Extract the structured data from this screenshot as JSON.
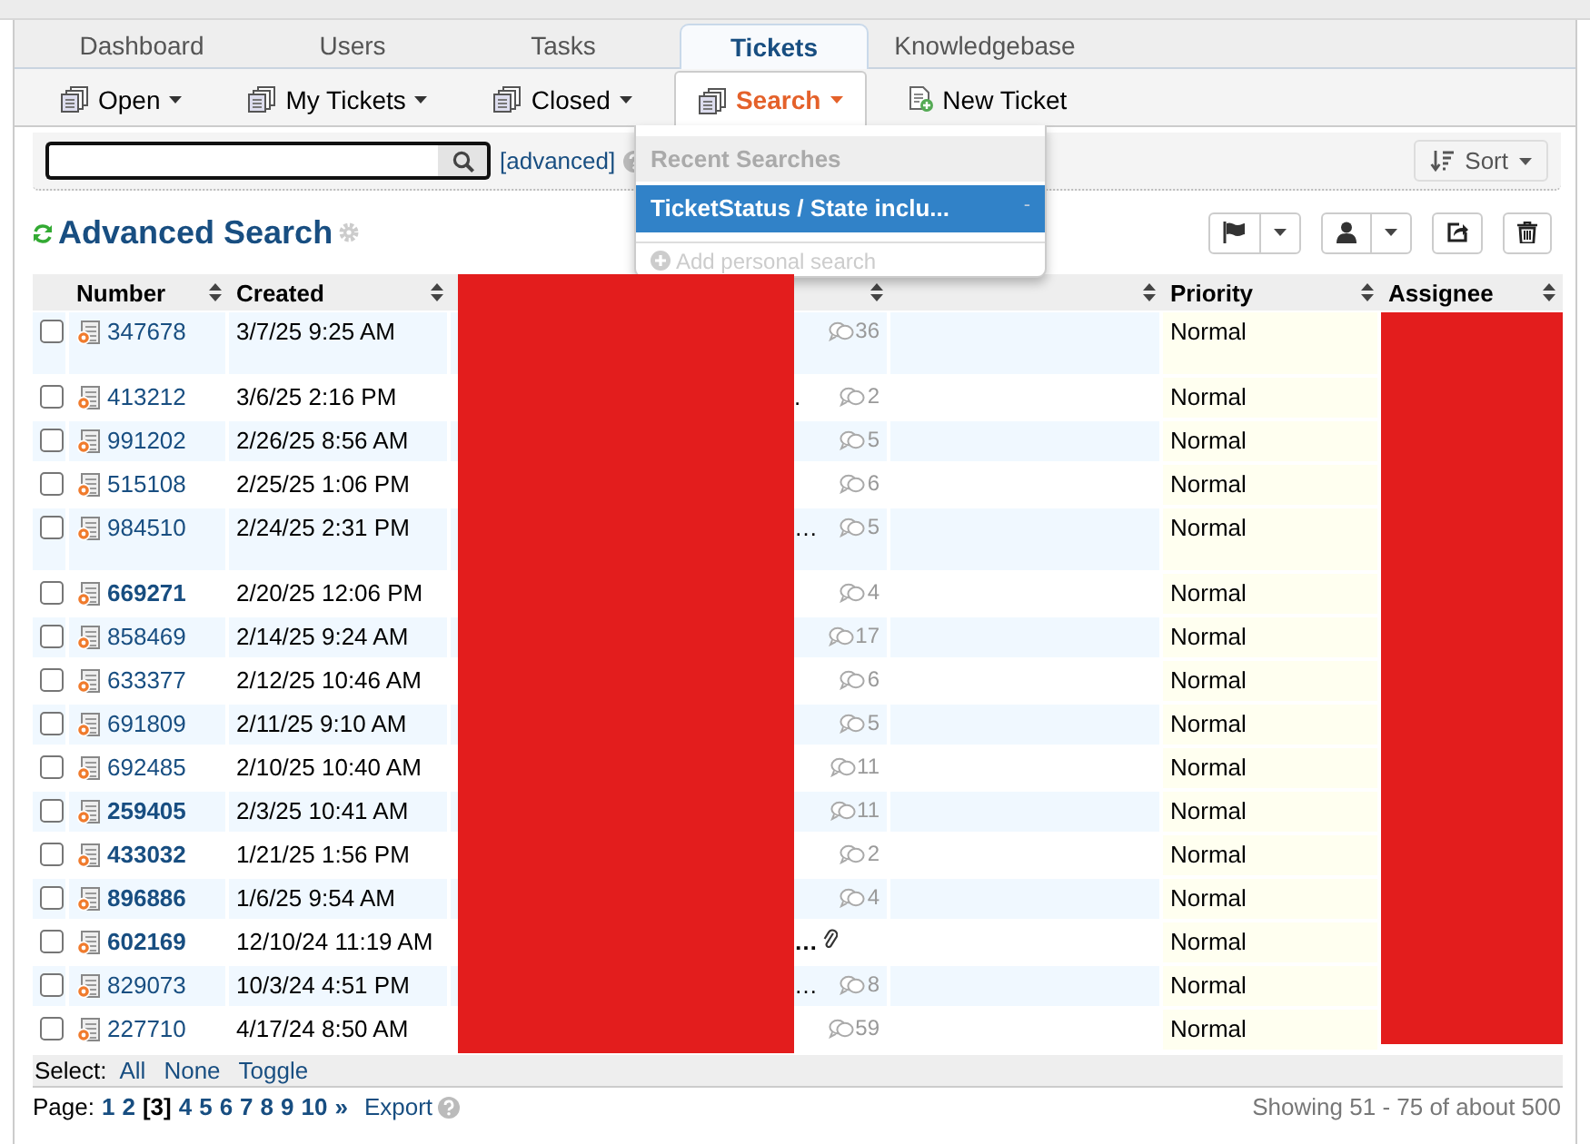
{
  "top_tabs": [
    {
      "label": "Dashboard",
      "selected": false
    },
    {
      "label": "Users",
      "selected": false
    },
    {
      "label": "Tasks",
      "selected": false
    },
    {
      "label": "Tickets",
      "selected": true
    },
    {
      "label": "Knowledgebase",
      "selected": false
    }
  ],
  "sub_nav": [
    {
      "label": "Open",
      "kind": "queue",
      "dropdown": true,
      "selected": false
    },
    {
      "label": "My Tickets",
      "kind": "queue",
      "dropdown": true,
      "selected": false
    },
    {
      "label": "Closed",
      "kind": "queue",
      "dropdown": true,
      "selected": false
    },
    {
      "label": "Search",
      "kind": "queue",
      "dropdown": true,
      "selected": true
    },
    {
      "label": "New Ticket",
      "kind": "create",
      "dropdown": false,
      "selected": false
    }
  ],
  "search_bar": {
    "advanced_link": "[advanced]",
    "sort_button": "Sort"
  },
  "search_menu": {
    "header": "Recent Searches",
    "items": [
      {
        "label": "TicketStatus / State inclu...",
        "remove": "-",
        "selected": true
      }
    ],
    "add_item": {
      "label": "Add personal search",
      "disabled": true
    }
  },
  "heading": "Advanced Search",
  "table": {
    "columns": [
      {
        "kind": "checkbox"
      },
      {
        "kind": "number",
        "label": "Number"
      },
      {
        "kind": "text",
        "label": "Created"
      },
      {
        "kind": "subject"
      },
      {
        "kind": "blank"
      },
      {
        "kind": "priority",
        "label": "Priority"
      },
      {
        "kind": "redacted",
        "label": "Assignee"
      }
    ],
    "rows": [
      {
        "number": "347678",
        "unread": false,
        "created": "3/7/25 9:25 AM",
        "count": "36",
        "attachment": false,
        "priority": "Normal",
        "checked": false,
        "tall": true
      },
      {
        "number": "413212",
        "unread": false,
        "created": "3/6/25 2:16 PM",
        "subject_tail": ".",
        "count": "2",
        "attachment": false,
        "priority": "Normal",
        "checked": false,
        "tall": false
      },
      {
        "number": "991202",
        "unread": false,
        "created": "2/26/25 8:56 AM",
        "count": "5",
        "attachment": false,
        "priority": "Normal",
        "checked": false,
        "tall": false
      },
      {
        "number": "515108",
        "unread": false,
        "created": "2/25/25 1:06 PM",
        "count": "6",
        "attachment": false,
        "priority": "Normal",
        "checked": false,
        "tall": false
      },
      {
        "number": "984510",
        "unread": false,
        "created": "2/24/25 2:31 PM",
        "subject_tail": "…",
        "count": "5",
        "attachment": false,
        "priority": "Normal",
        "checked": false,
        "tall": true
      },
      {
        "number": "669271",
        "unread": true,
        "created": "2/20/25 12:06 PM",
        "count": "4",
        "attachment": false,
        "priority": "Normal",
        "checked": false,
        "tall": false
      },
      {
        "number": "858469",
        "unread": false,
        "created": "2/14/25 9:24 AM",
        "count": "17",
        "attachment": false,
        "priority": "Normal",
        "checked": false,
        "tall": false
      },
      {
        "number": "633377",
        "unread": false,
        "created": "2/12/25 10:46 AM",
        "count": "6",
        "attachment": false,
        "priority": "Normal",
        "checked": false,
        "tall": false
      },
      {
        "number": "691809",
        "unread": false,
        "created": "2/11/25 9:10 AM",
        "count": "5",
        "attachment": false,
        "priority": "Normal",
        "checked": false,
        "tall": false
      },
      {
        "number": "692485",
        "unread": false,
        "created": "2/10/25 10:40 AM",
        "count": "11",
        "attachment": false,
        "priority": "Normal",
        "checked": false,
        "tall": false
      },
      {
        "number": "259405",
        "unread": true,
        "created": "2/3/25 10:41 AM",
        "count": "11",
        "attachment": false,
        "priority": "Normal",
        "checked": false,
        "tall": false
      },
      {
        "number": "433032",
        "unread": true,
        "created": "1/21/25 1:56 PM",
        "count": "2",
        "attachment": false,
        "priority": "Normal",
        "checked": false,
        "tall": false
      },
      {
        "number": "896886",
        "unread": true,
        "created": "1/6/25 9:54 AM",
        "count": "4",
        "attachment": false,
        "priority": "Normal",
        "checked": false,
        "tall": false
      },
      {
        "number": "602169",
        "unread": true,
        "created": "12/10/24 11:19 AM",
        "subject_tail": "…",
        "attachment": true,
        "priority": "Normal",
        "checked": false,
        "tall": false
      },
      {
        "number": "829073",
        "unread": false,
        "created": "10/3/24 4:51 PM",
        "subject_tail": "…",
        "count": "8",
        "attachment": false,
        "priority": "Normal",
        "checked": false,
        "tall": false
      },
      {
        "number": "227710",
        "unread": false,
        "created": "4/17/24 8:50 AM",
        "count": "59",
        "attachment": false,
        "priority": "Normal",
        "checked": false,
        "tall": false
      }
    ]
  },
  "select_bar": {
    "label": "Select:",
    "links": [
      "All",
      "None",
      "Toggle"
    ]
  },
  "pager": {
    "label": "Page:",
    "pages": [
      {
        "label": "1",
        "selected": false
      },
      {
        "label": "2",
        "selected": false
      },
      {
        "label": "[3]",
        "selected": true
      },
      {
        "label": "4",
        "selected": false
      },
      {
        "label": "5",
        "selected": false
      },
      {
        "label": "6",
        "selected": false
      },
      {
        "label": "7",
        "selected": false
      },
      {
        "label": "8",
        "selected": false
      },
      {
        "label": "9",
        "selected": false
      },
      {
        "label": "10",
        "selected": false
      },
      {
        "label": "»",
        "selected": false
      }
    ],
    "export": "Export"
  },
  "status": "Showing 51 - 75 of about 500"
}
